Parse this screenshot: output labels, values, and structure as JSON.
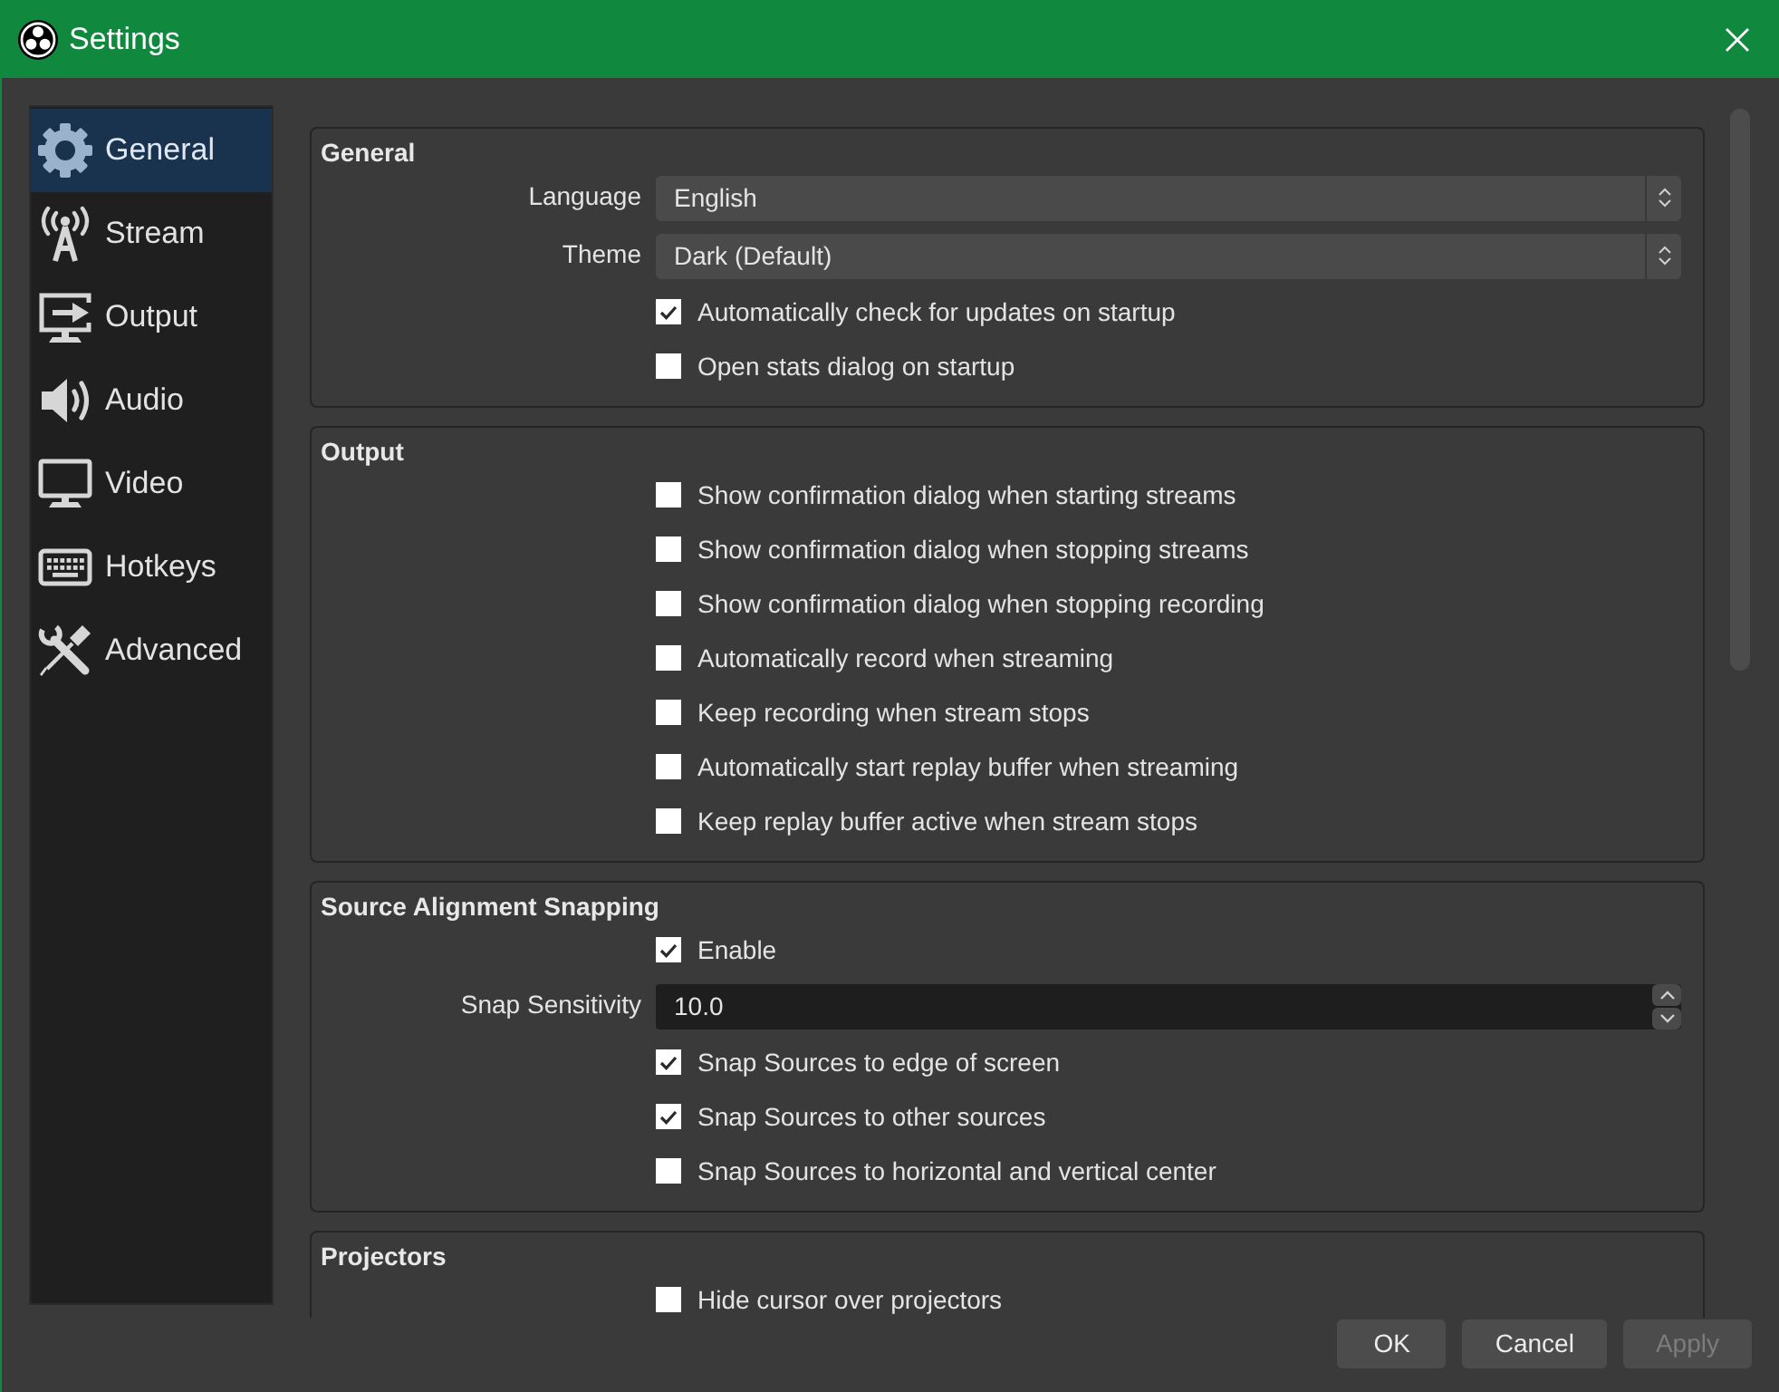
{
  "window": {
    "title": "Settings"
  },
  "sidebar": {
    "items": [
      {
        "label": "General",
        "selected": true
      },
      {
        "label": "Stream",
        "selected": false
      },
      {
        "label": "Output",
        "selected": false
      },
      {
        "label": "Audio",
        "selected": false
      },
      {
        "label": "Video",
        "selected": false
      },
      {
        "label": "Hotkeys",
        "selected": false
      },
      {
        "label": "Advanced",
        "selected": false
      }
    ]
  },
  "groups": [
    {
      "title": "General",
      "rows": [
        {
          "kind": "dropdown",
          "label": "Language",
          "value": "English"
        },
        {
          "kind": "dropdown",
          "label": "Theme",
          "value": "Dark (Default)"
        },
        {
          "kind": "checkbox",
          "label": "Automatically check for updates on startup",
          "checked": true
        },
        {
          "kind": "checkbox",
          "label": "Open stats dialog on startup",
          "checked": false
        }
      ]
    },
    {
      "title": "Output",
      "rows": [
        {
          "kind": "checkbox",
          "label": "Show confirmation dialog when starting streams",
          "checked": false
        },
        {
          "kind": "checkbox",
          "label": "Show confirmation dialog when stopping streams",
          "checked": false
        },
        {
          "kind": "checkbox",
          "label": "Show confirmation dialog when stopping recording",
          "checked": false
        },
        {
          "kind": "checkbox",
          "label": "Automatically record when streaming",
          "checked": false
        },
        {
          "kind": "checkbox",
          "label": "Keep recording when stream stops",
          "checked": false
        },
        {
          "kind": "checkbox",
          "label": "Automatically start replay buffer when streaming",
          "checked": false
        },
        {
          "kind": "checkbox",
          "label": "Keep replay buffer active when stream stops",
          "checked": false
        }
      ]
    },
    {
      "title": "Source Alignment Snapping",
      "rows": [
        {
          "kind": "checkbox",
          "label": "Enable",
          "checked": true
        },
        {
          "kind": "spinbox",
          "label": "Snap Sensitivity",
          "value": "10.0"
        },
        {
          "kind": "checkbox",
          "label": "Snap Sources to edge of screen",
          "checked": true
        },
        {
          "kind": "checkbox",
          "label": "Snap Sources to other sources",
          "checked": true
        },
        {
          "kind": "checkbox",
          "label": "Snap Sources to horizontal and vertical center",
          "checked": false
        }
      ]
    },
    {
      "title": "Projectors",
      "rows": [
        {
          "kind": "checkbox",
          "label": "Hide cursor over projectors",
          "checked": false
        }
      ]
    }
  ],
  "buttons": [
    {
      "label": "OK",
      "disabled": false
    },
    {
      "label": "Cancel",
      "disabled": false
    },
    {
      "label": "Apply",
      "disabled": true
    }
  ]
}
